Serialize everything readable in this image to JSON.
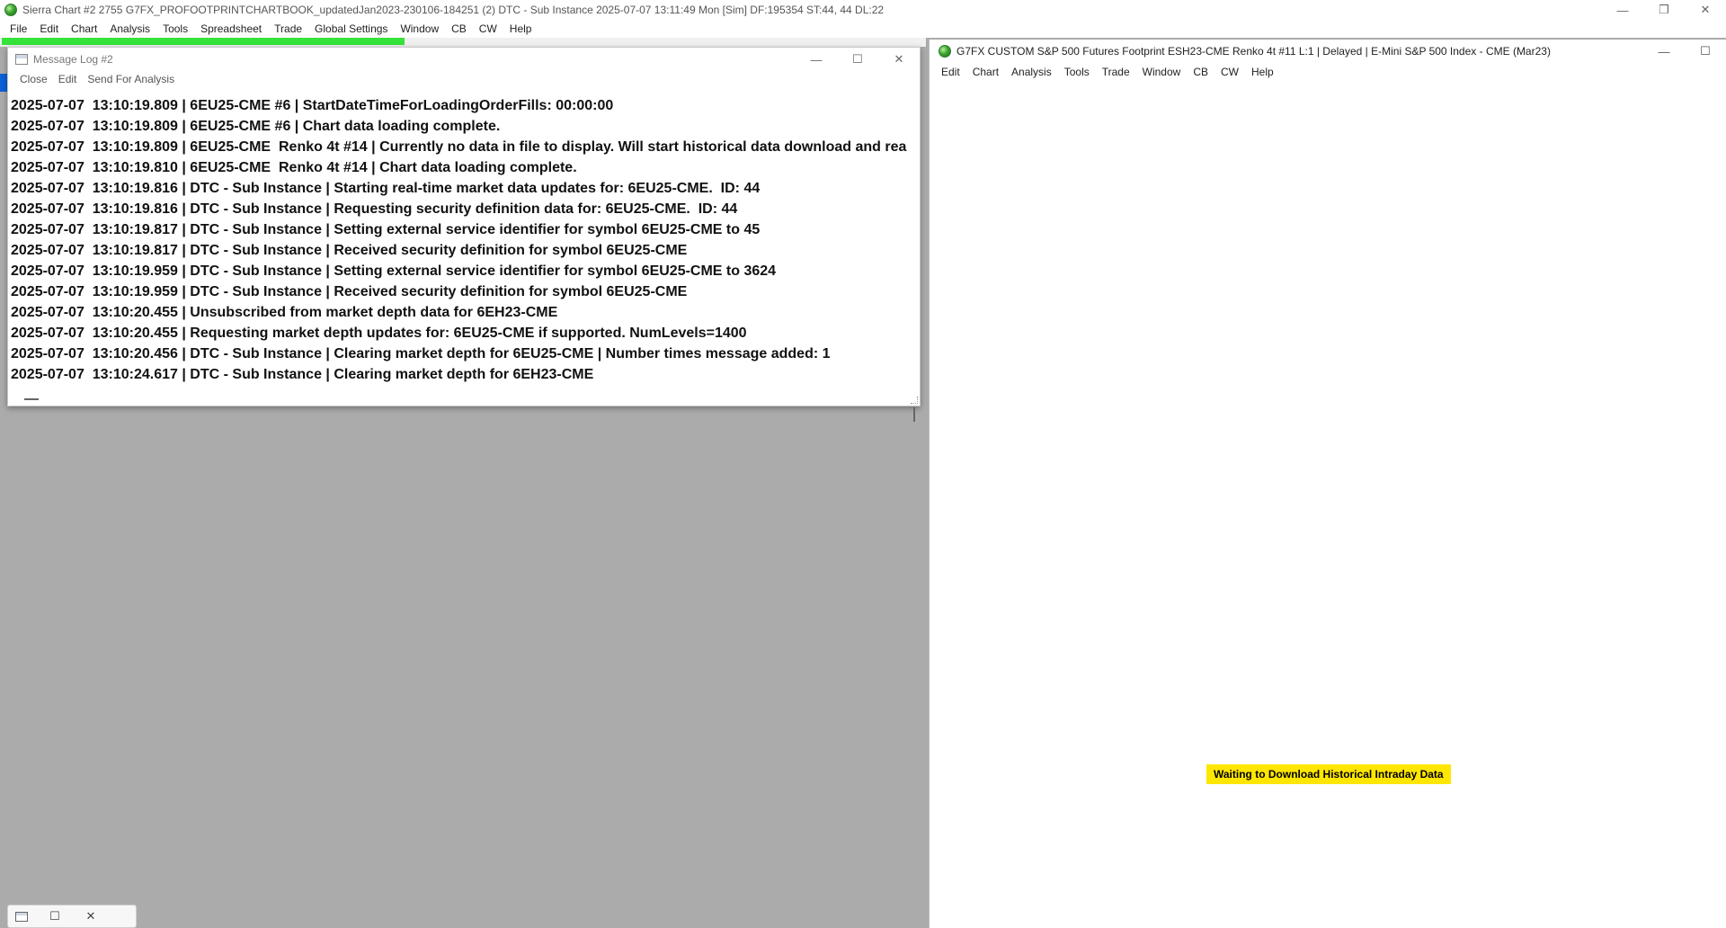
{
  "app": {
    "title": "Sierra Chart #2 2755 G7FX_PROFOOTPRINTCHARTBOOK_updatedJan2023-230106-184251 (2) DTC - Sub Instance 2025-07-07  13:11:49 Mon [Sim] DF:195354  ST:44, 44  DL:22",
    "menu": [
      "File",
      "Edit",
      "Chart",
      "Analysis",
      "Tools",
      "Spreadsheet",
      "Trade",
      "Global Settings",
      "Window",
      "CB",
      "CW",
      "Help"
    ]
  },
  "message_log": {
    "title": "Message Log #2",
    "menu": [
      "Close",
      "Edit",
      "Send For Analysis"
    ],
    "lines": [
      "2025-07-07  13:10:19.809 | 6EU25-CME #6 | StartDateTimeForLoadingOrderFills: 00:00:00",
      "2025-07-07  13:10:19.809 | 6EU25-CME #6 | Chart data loading complete.",
      "2025-07-07  13:10:19.809 | 6EU25-CME  Renko 4t #14 | Currently no data in file to display. Will start historical data download and real-",
      "2025-07-07  13:10:19.810 | 6EU25-CME  Renko 4t #14 | Chart data loading complete.",
      "2025-07-07  13:10:19.816 | DTC - Sub Instance | Starting real-time market data updates for: 6EU25-CME.  ID: 44",
      "2025-07-07  13:10:19.816 | DTC - Sub Instance | Requesting security definition data for: 6EU25-CME.  ID: 44",
      "2025-07-07  13:10:19.817 | DTC - Sub Instance | Setting external service identifier for symbol 6EU25-CME to 45",
      "2025-07-07  13:10:19.817 | DTC - Sub Instance | Received security definition for symbol 6EU25-CME",
      "2025-07-07  13:10:19.959 | DTC - Sub Instance | Setting external service identifier for symbol 6EU25-CME to 3624",
      "2025-07-07  13:10:19.959 | DTC - Sub Instance | Received security definition for symbol 6EU25-CME",
      "2025-07-07  13:10:20.455 | Unsubscribed from market depth data for 6EH23-CME",
      "2025-07-07  13:10:20.455 | Requesting market depth updates for: 6EU25-CME if supported. NumLevels=1400",
      "2025-07-07  13:10:20.456 | DTC - Sub Instance | Clearing market depth for 6EU25-CME | Number times message added: 1",
      "2025-07-07  13:10:24.617 | DTC - Sub Instance | Clearing market depth for 6EH23-CME"
    ]
  },
  "chart_window": {
    "title": "G7FX CUSTOM S&P 500 Futures Footprint ESH23-CME  Renko 4t #11 L:1 | Delayed | E-Mini S&P 500 Index - CME (Mar23)",
    "menu": [
      "Edit",
      "Chart",
      "Analysis",
      "Tools",
      "Trade",
      "Window",
      "CB",
      "CW",
      "Help"
    ],
    "status": "Waiting to Download Historical Intraday Data"
  },
  "colors": {
    "status_badge": "#ffe600",
    "green_strip": "#35e33a",
    "mdi_background": "#ababab"
  },
  "icons": {
    "minimize": "minimize-icon",
    "maximize": "maximize-icon",
    "restore": "restore-icon",
    "close": "close-icon"
  }
}
